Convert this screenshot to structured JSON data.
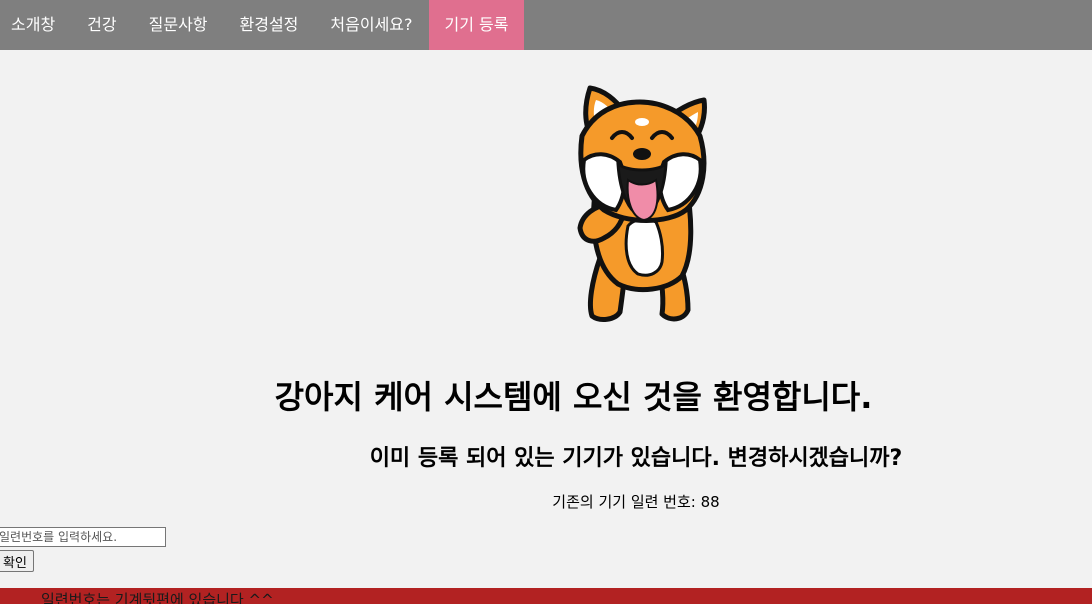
{
  "nav": {
    "items": [
      {
        "label": "소개창"
      },
      {
        "label": "건강"
      },
      {
        "label": "질문사항"
      },
      {
        "label": "환경설정"
      },
      {
        "label": "처음이세요?"
      },
      {
        "label": "기기 등록",
        "active": true
      }
    ],
    "bar_color": "#7f7f7f",
    "active_color": "#e06f8f"
  },
  "main": {
    "mascot_icon": "shiba-dog-laughing-icon",
    "title": "강아지 케어 시스템에 오신 것을 환영합니다.",
    "subtitle": "이미 등록 되어 있는 기기가 있습니다. 변경하시겠습니까?",
    "serial_label": "기존의 기기 일련 번호:",
    "serial_value": "88"
  },
  "form": {
    "serial_placeholder": "일련번호를 입력하세요.",
    "serial_value": "",
    "confirm_label": "확인"
  },
  "footer": {
    "text": "일련번호는 기계뒷편에 있습니다 ^^",
    "color": "#b22222"
  }
}
